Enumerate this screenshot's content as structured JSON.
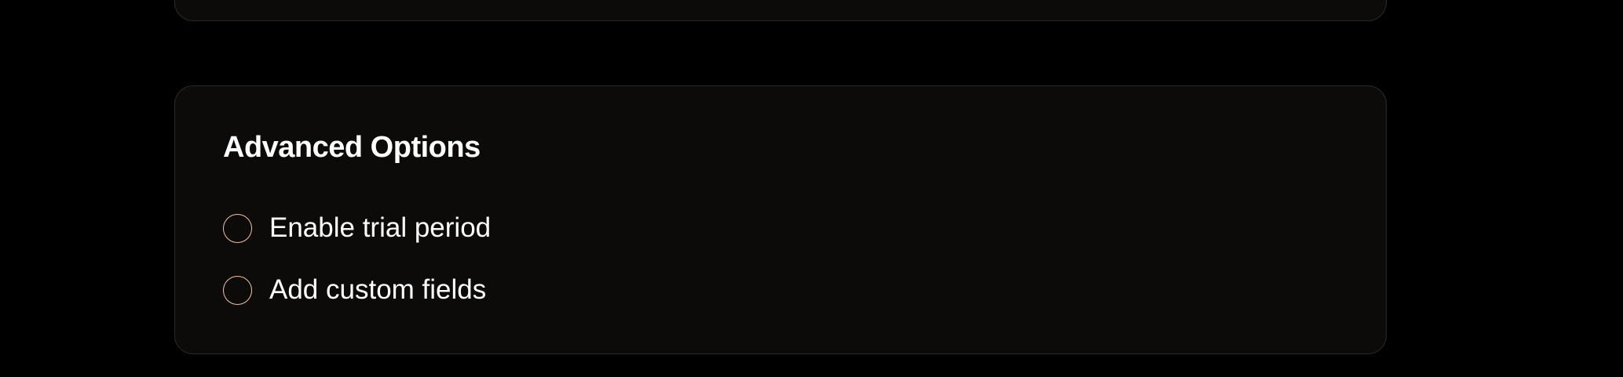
{
  "advanced": {
    "title": "Advanced Options",
    "options": [
      {
        "label": "Enable trial period",
        "checked": false
      },
      {
        "label": "Add custom fields",
        "checked": false
      }
    ]
  },
  "colors": {
    "background": "#000000",
    "card": "#0c0b0a",
    "card_border": "#2a2a2a",
    "radio_accent": "#f0c2a4",
    "text": "#ffffff"
  }
}
